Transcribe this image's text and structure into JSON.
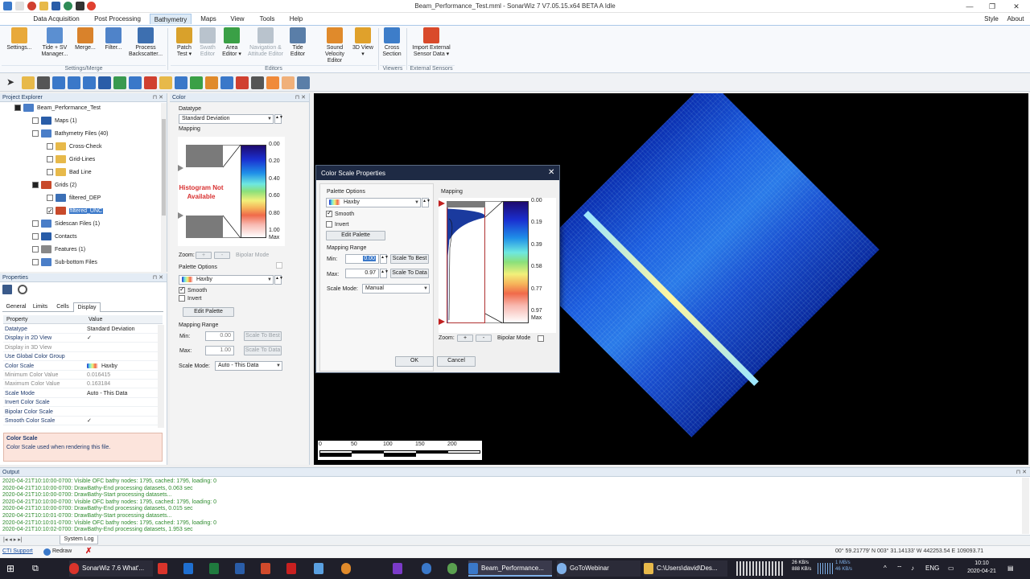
{
  "window": {
    "title": "Beam_Performance_Test.mml - SonarWiz 7 V7.05.15.x64 BETA A  Idle",
    "style_label": "Style",
    "about_label": "About"
  },
  "menus": [
    {
      "label": "Data Acquisition"
    },
    {
      "label": "Post Processing"
    },
    {
      "label": "Bathymetry"
    },
    {
      "label": "Maps"
    },
    {
      "label": "View"
    },
    {
      "label": "Tools"
    },
    {
      "label": "Help"
    }
  ],
  "ribbon": {
    "buttons": [
      {
        "label": "Settings...",
        "color": "#e8a93a"
      },
      {
        "label": "Tide + SV Manager...",
        "color": "#5b8fd1"
      },
      {
        "label": "Merge...",
        "color": "#d9822b"
      },
      {
        "label": "Filter...",
        "color": "#4f83c9"
      },
      {
        "label": "Process Backscatter...",
        "color": "#3d6fb0"
      },
      {
        "label": "Patch Test ▾",
        "color": "#d9a12b"
      },
      {
        "label": "Swath Editor",
        "color": "#b9c3cd"
      },
      {
        "label": "Area Editor ▾",
        "color": "#3aa046"
      },
      {
        "label": "Navigation & Attitude Editor",
        "color": "#b9c3cd"
      },
      {
        "label": "Tide Editor",
        "color": "#5a7ea8"
      },
      {
        "label": "Sound Velocity Editor",
        "color": "#e08a2b"
      },
      {
        "label": "3D View ▾",
        "color": "#e0a12b"
      },
      {
        "label": "Cross Section",
        "color": "#3d7dc9"
      },
      {
        "label": "Import External Sensor Data ▾",
        "color": "#d94a2b"
      }
    ],
    "groups": [
      {
        "label": "Settings/Merge"
      },
      {
        "label": "Editors"
      },
      {
        "label": "Viewers"
      },
      {
        "label": "External Sensors"
      }
    ]
  },
  "project_explorer": {
    "title": "Project Explorer",
    "items": [
      {
        "label": "Beam_Performance_Test",
        "color": "#4a7ec8"
      },
      {
        "label": "Maps (1)",
        "color": "#2a5da8"
      },
      {
        "label": "Bathymetry Files (40)",
        "color": "#4a7ec8"
      },
      {
        "label": "Cross-Check",
        "color": "#e7b94a"
      },
      {
        "label": "Grid-Lines",
        "color": "#e7b94a"
      },
      {
        "label": "Bad Line",
        "color": "#e7b94a"
      },
      {
        "label": "Grids (2)",
        "color": "#c84a2b"
      },
      {
        "label": "filtered_DEP",
        "color": "#3b6fb6"
      },
      {
        "label": "filtered_UNC",
        "color": "#c84a2b"
      },
      {
        "label": "Sidescan Files (1)",
        "color": "#4a7ec8"
      },
      {
        "label": "Contacts",
        "color": "#2a5da8"
      },
      {
        "label": "Features (1)",
        "color": "#888888"
      },
      {
        "label": "Sub-bottom Files",
        "color": "#4a7ec8"
      }
    ]
  },
  "properties": {
    "title": "Properties",
    "tabs": [
      "General",
      "Limits",
      "Cells",
      "Display"
    ],
    "active_tab": "Display",
    "header_property": "Property",
    "header_value": "Value",
    "rows": [
      {
        "k": "Datatype",
        "v": "Standard Deviation"
      },
      {
        "k": "Display in 2D View",
        "v": "✓"
      },
      {
        "k": "Display in 3D View",
        "v": ""
      },
      {
        "k": "Use Global Color Group",
        "v": ""
      },
      {
        "k": "Color Scale",
        "v": "Haxby"
      },
      {
        "k": "Minimum Color Value",
        "v": "0.016415"
      },
      {
        "k": "Maximum Color Value",
        "v": "0.163184"
      },
      {
        "k": "Scale Mode",
        "v": "Auto - This Data"
      },
      {
        "k": "Invert Color Scale",
        "v": ""
      },
      {
        "k": "Bipolar Color Scale",
        "v": ""
      },
      {
        "k": "Smooth Color Scale",
        "v": "✓"
      }
    ],
    "desc_title": "Color Scale",
    "desc_text": "Color Scale used when rendering this file."
  },
  "color_panel": {
    "title": "Color",
    "datatype_label": "Datatype",
    "datatype_value": "Standard Deviation",
    "mapping_label": "Mapping",
    "histogram_text": "Histogram Not Available",
    "ticks": [
      "0.00",
      "0.20",
      "0.40",
      "0.60",
      "0.80",
      "1.00",
      "Max"
    ],
    "zoom_label": "Zoom:",
    "zoom_plus": "+",
    "zoom_minus": "-",
    "bipolar_label": "Bipolar Mode",
    "palette_options_label": "Palette Options",
    "palette_value": "Haxby",
    "smooth_label": "Smooth",
    "invert_label": "Invert",
    "edit_palette_label": "Edit Palette",
    "mapping_range_label": "Mapping Range",
    "min_label": "Min:",
    "min_value": "0.00",
    "max_label": "Max:",
    "max_value": "1.00",
    "scale_to_best": "Scale To Best",
    "scale_to_data": "Scale To Data",
    "scale_mode_label": "Scale Mode:",
    "scale_mode_value": "Auto - This Data"
  },
  "dialog": {
    "title": "Color Scale Properties",
    "palette_options_label": "Palette Options",
    "palette_value": "Haxby",
    "smooth_label": "Smooth",
    "invert_label": "Invert",
    "edit_palette_label": "Edit Palette",
    "mapping_range_label": "Mapping Range",
    "min_label": "Min:",
    "min_value": "0.00",
    "max_label": "Max:",
    "max_value": "0.97",
    "scale_to_best": "Scale To Best",
    "scale_to_data": "Scale To Data",
    "scale_mode_label": "Scale Mode:",
    "scale_mode_value": "Manual",
    "mapping_label": "Mapping",
    "ticks": [
      "0.00",
      "0.19",
      "0.39",
      "0.58",
      "0.77",
      "0.97",
      "Max"
    ],
    "zoom_label": "Zoom:",
    "zoom_plus": "+",
    "zoom_minus": "-",
    "bipolar_label": "Bipolar Mode",
    "ok_label": "OK",
    "cancel_label": "Cancel"
  },
  "map": {
    "scale_labels": [
      "0",
      "50",
      "100",
      "150",
      "200"
    ]
  },
  "output": {
    "title": "Output",
    "lines": [
      "2020-04-21T10:10:00-0700: Visible OFC bathy nodes: 1795, cached: 1795, loading: 0",
      "2020-04-21T10:10:00-0700: DrawBathy-End processing datasets, 0.063 sec",
      "2020-04-21T10:10:00-0700: DrawBathy-Start processing datasets...",
      "2020-04-21T10:10:00-0700: Visible OFC bathy nodes: 1795, cached: 1795, loading: 0",
      "2020-04-21T10:10:00-0700: DrawBathy-End processing datasets, 0.015 sec",
      "2020-04-21T10:10:01-0700: DrawBathy-Start processing datasets...",
      "2020-04-21T10:10:01-0700: Visible OFC bathy nodes: 1795, cached: 1795, loading: 0",
      "2020-04-21T10:10:02-0700: DrawBathy-End processing datasets, 1.953 sec"
    ],
    "tab_label": "System Log"
  },
  "statusbar": {
    "ctisupport": "CTI Support",
    "redraw": "Redraw",
    "coords": "00° 59.21779' N  003° 31.14133' W     442253.54 E 109093.71"
  },
  "taskbar": {
    "apps": [
      {
        "label": "SonarWiz 7.6 What'...",
        "color": "#d9342b"
      },
      {
        "label": "Beam_Performance...",
        "color": "#3a78c9"
      },
      {
        "label": "GoToWebinar",
        "color": "#7fb0e8"
      },
      {
        "label": "C:\\Users\\david\\Des...",
        "color": "#e7b94a"
      }
    ],
    "net_up": "26 KB/s",
    "net_down": "888 KB/s",
    "disk_up": "1 MB/s",
    "disk_down": "46 KB/s",
    "lang": "ENG",
    "time": "10:10",
    "date": "2020-04-21"
  }
}
